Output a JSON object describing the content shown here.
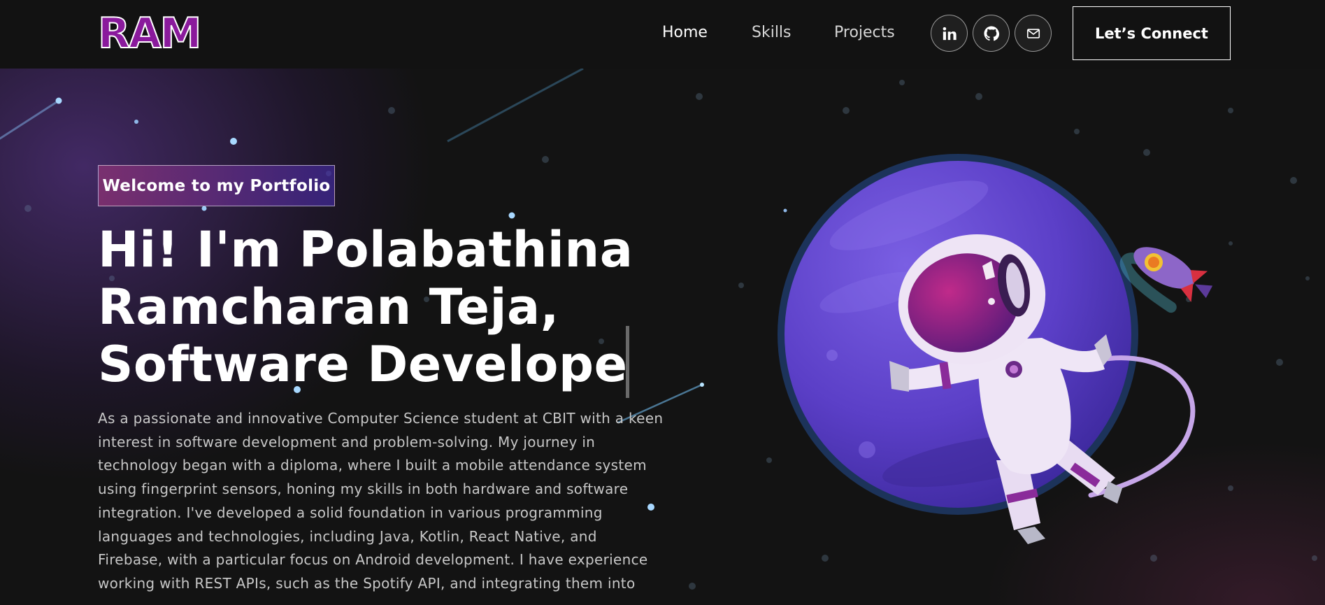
{
  "navbar": {
    "logo": "RAM",
    "links": [
      {
        "label": "Home",
        "active": true
      },
      {
        "label": "Skills",
        "active": false
      },
      {
        "label": "Projects",
        "active": false
      }
    ],
    "social_icons": [
      "linkedin-icon",
      "github-icon",
      "mail-icon"
    ],
    "connect_label": "Let’s Connect"
  },
  "hero": {
    "tagline": "Welcome to my Portfolio",
    "headline_lines": [
      "Hi! I'm Polabathina",
      "Ramcharan Teja,",
      "Software Develope"
    ],
    "bio_lines": [
      "As a passionate and innovative Computer Science student at CBIT with a keen",
      "interest in software development and problem-solving. My journey in",
      "technology began with a diploma, where I built a mobile attendance system",
      "using fingerprint sensors, honing my skills in both hardware and software",
      "integration. I've developed a solid foundation in various programming",
      "languages and technologies, including Java, Kotlin, React Native, and",
      "Firebase, with a particular focus on Android development. I have experience",
      "working with REST APIs, such as the Spotify API, and integrating them into"
    ]
  },
  "colors": {
    "background": "#121212",
    "logo_fill": "#8a1a9c",
    "tag_gradient_start": "#aa367c",
    "tag_gradient_end": "#4a2fbd",
    "planet": "#6a4fd6"
  }
}
